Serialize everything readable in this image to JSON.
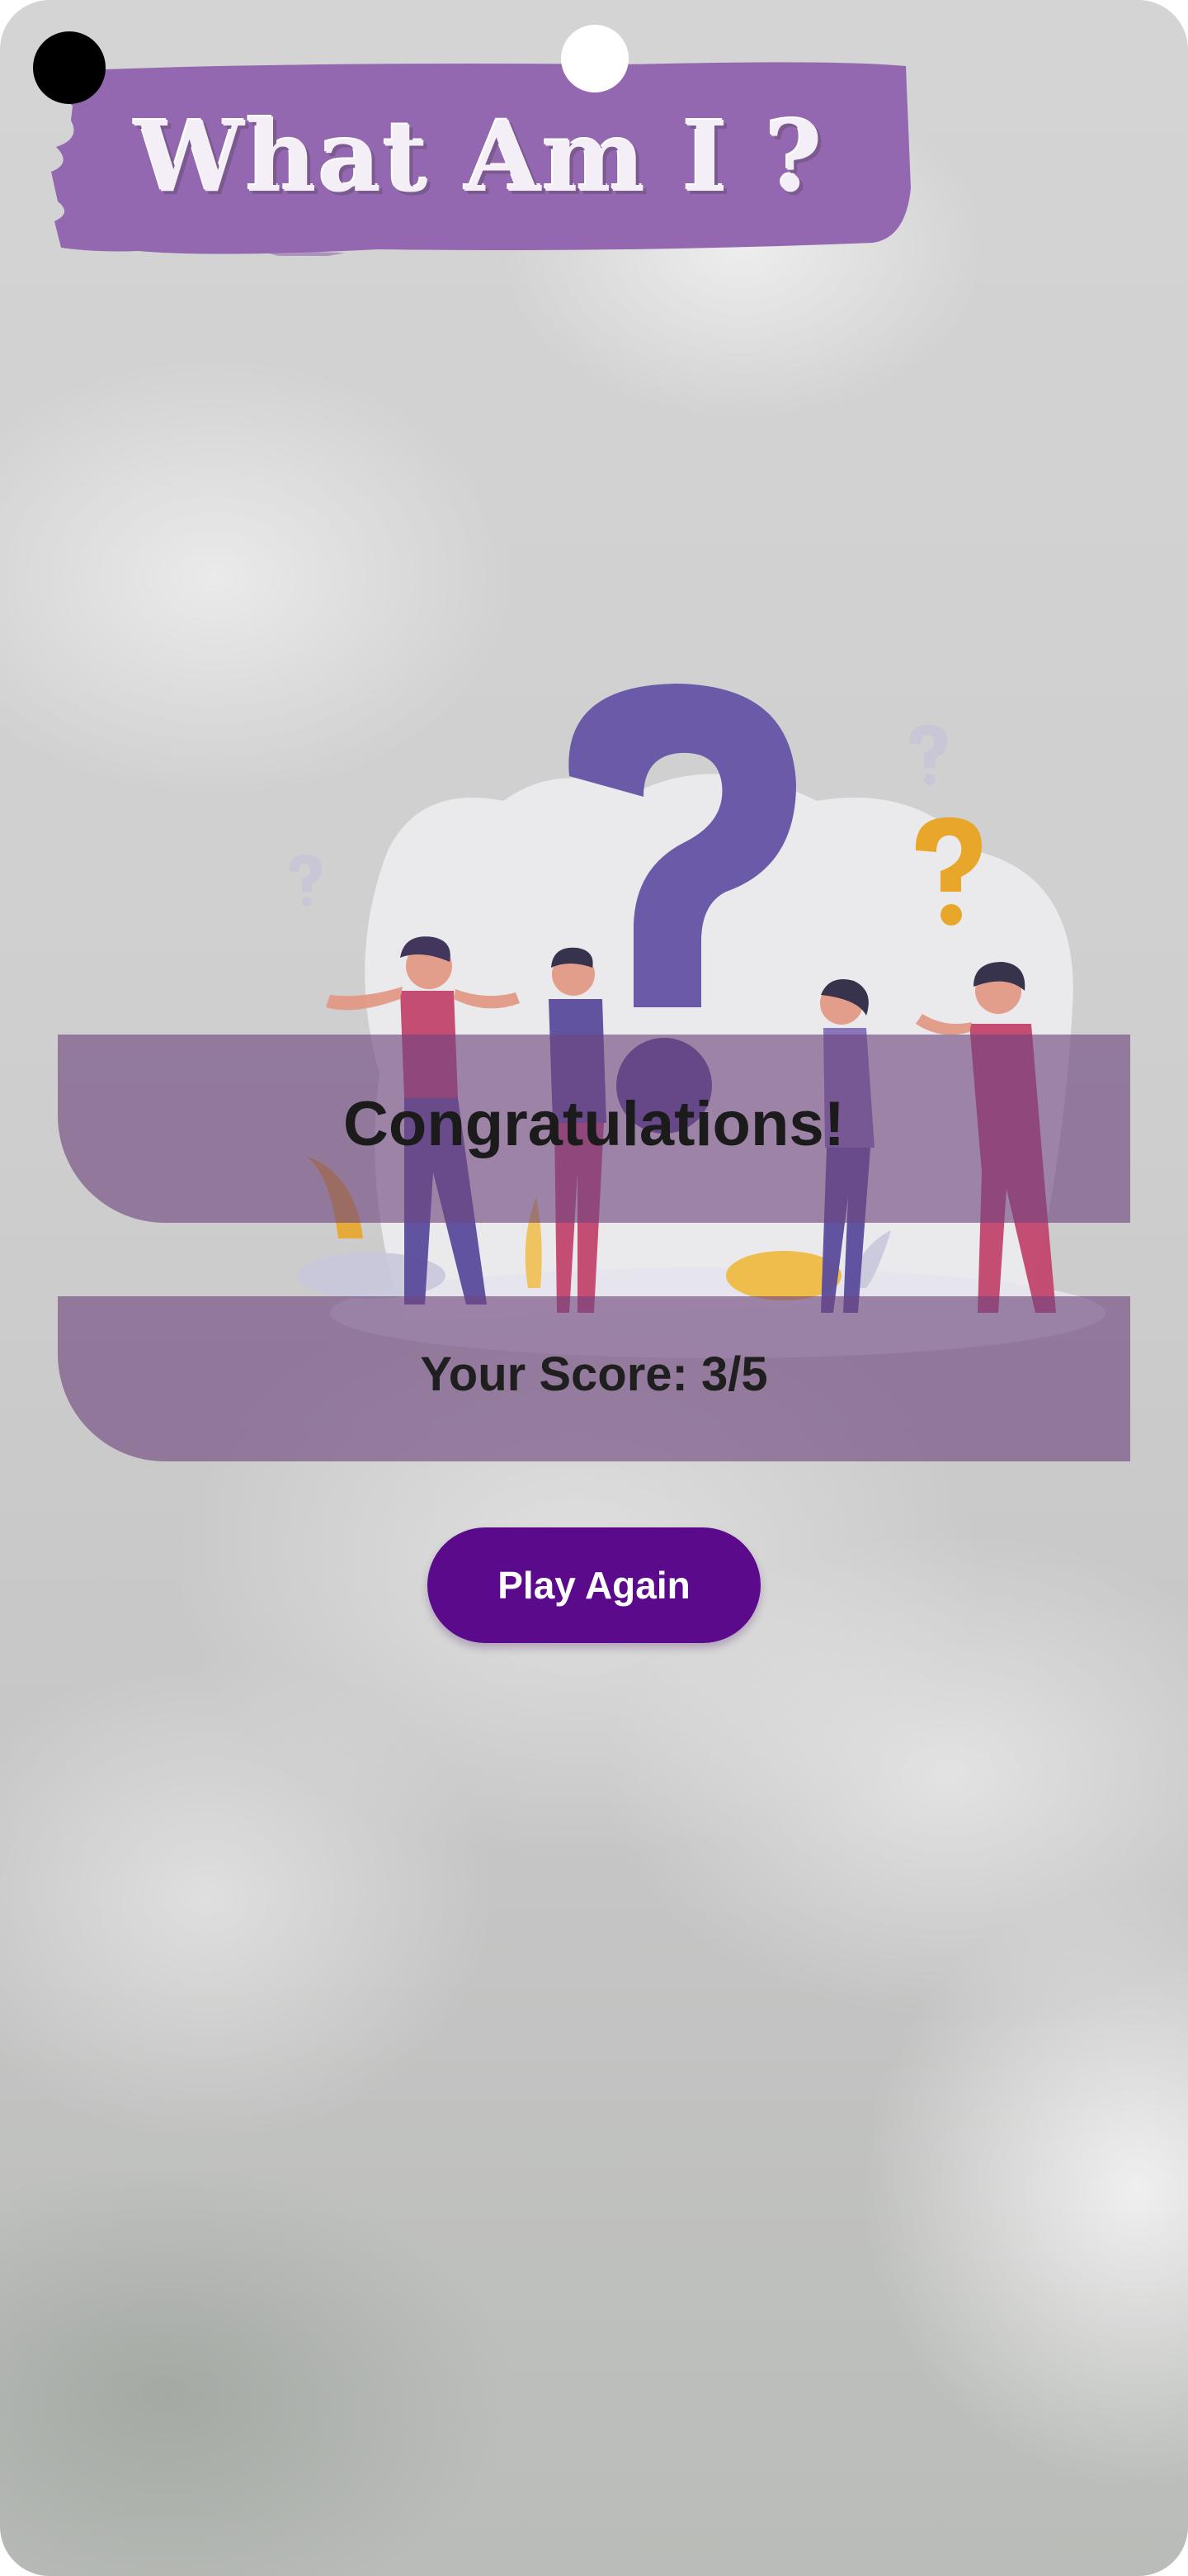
{
  "app": {
    "title": "What Am I ?"
  },
  "result": {
    "heading": "Congratulations!",
    "score_text": "Your Score: 3/5"
  },
  "actions": {
    "play_again_label": "Play Again"
  },
  "colors": {
    "banner": "#9468b0",
    "band": "#6e467d",
    "button": "#5c0a8c",
    "question_mark": "#6a5aa8",
    "accent_yellow": "#e8a72a",
    "person_pink": "#c2456e"
  },
  "icons": [
    "question-mark-illustration",
    "small-question-mark-icon"
  ]
}
